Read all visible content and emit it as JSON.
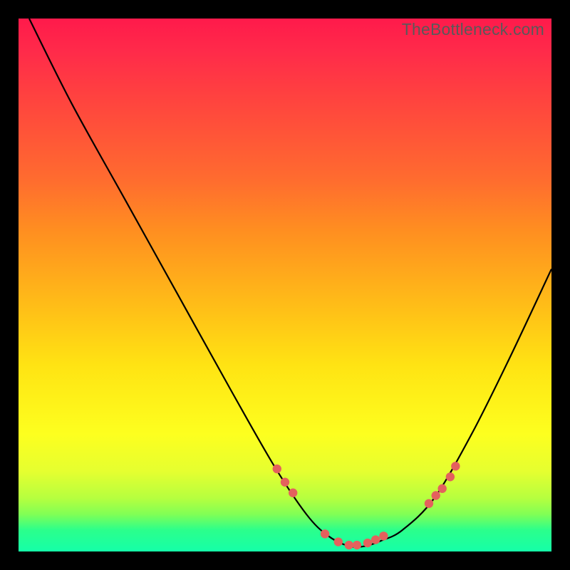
{
  "watermark": "TheBottleneck.com",
  "gradient_colors": {
    "top": "#ff1a4b",
    "mid": "#ffe313",
    "bottom": "#15ffa8"
  },
  "curve_color": "#000000",
  "marker_color": "#e4615d",
  "chart_data": {
    "type": "line",
    "title": "",
    "xlabel": "",
    "ylabel": "",
    "xlim": [
      0,
      100
    ],
    "ylim": [
      0,
      100
    ],
    "series": [
      {
        "name": "bottleneck-curve",
        "x": [
          2,
          10,
          20,
          30,
          40,
          48,
          54,
          58,
          62,
          65,
          68,
          72,
          78,
          85,
          92,
          100
        ],
        "y": [
          100,
          84,
          66,
          48,
          30,
          16,
          7,
          3,
          1,
          1,
          2,
          4,
          10,
          22,
          36,
          53
        ]
      }
    ],
    "markers": {
      "name": "highlighted-points",
      "x": [
        48.5,
        50.0,
        51.5,
        57.5,
        60.0,
        62.0,
        63.5,
        65.5,
        67.0,
        68.5,
        77.0,
        78.3,
        79.5,
        81.0,
        82.0
      ],
      "y": [
        15.5,
        13.0,
        11.0,
        3.3,
        1.8,
        1.2,
        1.2,
        1.6,
        2.2,
        2.9,
        9.0,
        10.5,
        11.8,
        14.0,
        16.0
      ]
    }
  }
}
